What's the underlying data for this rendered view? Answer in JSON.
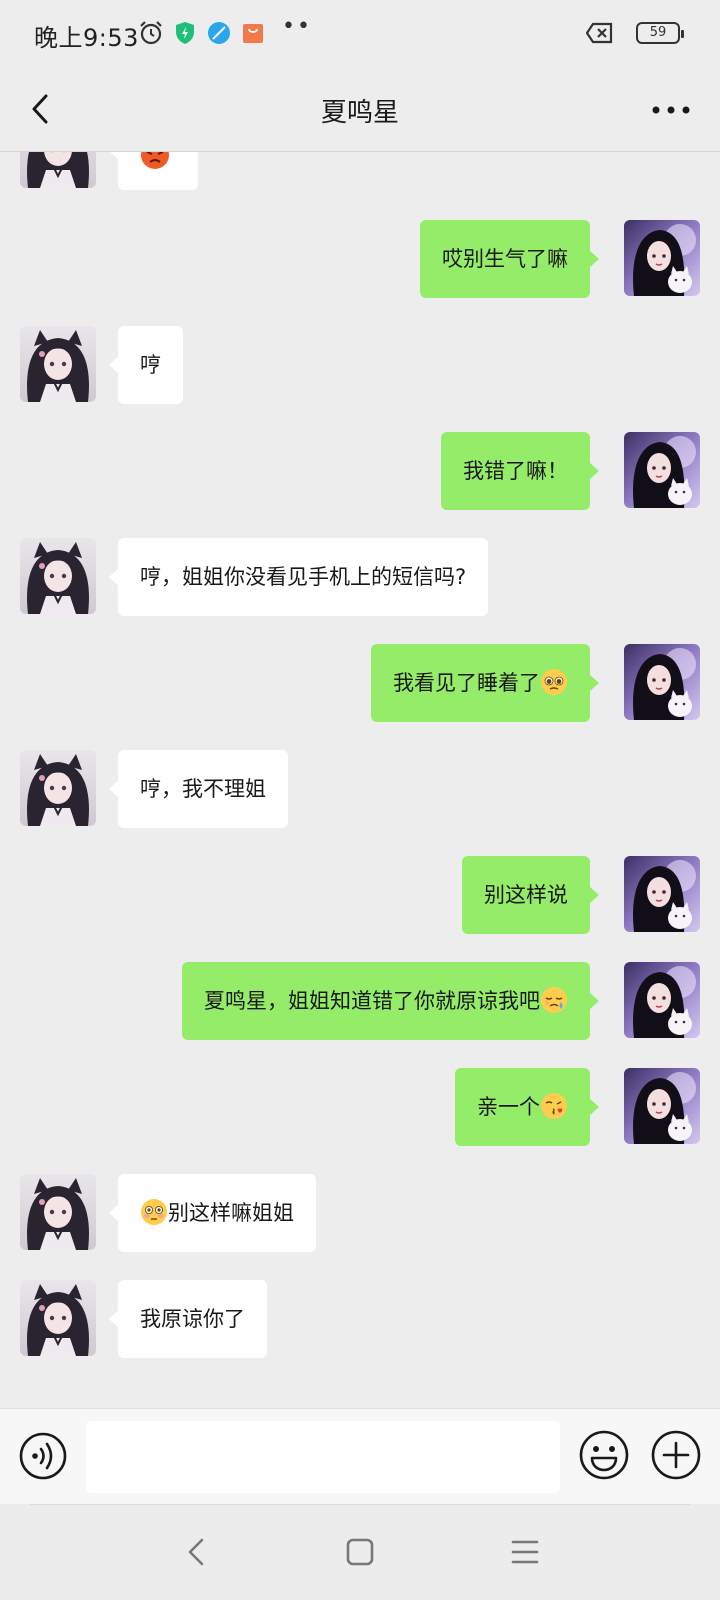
{
  "status_bar": {
    "time": "晚上9:53",
    "battery": "59"
  },
  "header": {
    "title": "夏鸣星"
  },
  "messages": [
    {
      "side": "right",
      "text": "哎别生气了嘛",
      "emoji": ""
    },
    {
      "side": "left",
      "text": "哼",
      "emoji": ""
    },
    {
      "side": "right",
      "text": "我错了嘛！",
      "emoji": ""
    },
    {
      "side": "left",
      "text": "哼，姐姐你没看见手机上的短信吗?",
      "emoji": ""
    },
    {
      "side": "right",
      "text": "我看见了睡着了",
      "emoji": "pleading-face-emoji"
    },
    {
      "side": "left",
      "text": "哼，我不理姐",
      "emoji": ""
    },
    {
      "side": "right",
      "text": "别这样说",
      "emoji": ""
    },
    {
      "side": "right",
      "text": "夏鸣星，姐姐知道错了你就原谅我吧",
      "emoji": "sleepy-face-emoji"
    },
    {
      "side": "right",
      "text": "亲一个",
      "emoji": "kissing-face-emoji"
    },
    {
      "side": "left",
      "text": "别这样嘛姐姐",
      "emoji": "flushed-face-emoji"
    },
    {
      "side": "left",
      "text": "我原谅你了",
      "emoji": ""
    }
  ],
  "colors": {
    "background": "#ededed",
    "sent_bubble": "#95ec69",
    "received_bubble": "#ffffff"
  },
  "input": {
    "value": "",
    "placeholder": ""
  }
}
